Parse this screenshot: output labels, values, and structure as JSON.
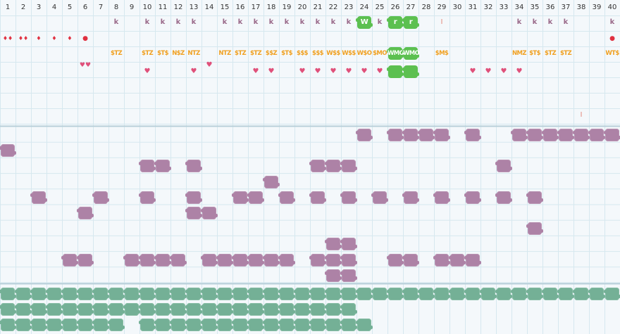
{
  "columns": [
    1,
    2,
    3,
    4,
    5,
    6,
    7,
    8,
    9,
    10,
    11,
    12,
    13,
    14,
    15,
    16,
    17,
    18,
    19,
    20,
    21,
    22,
    23,
    24,
    25,
    26,
    27,
    28,
    29,
    30,
    31,
    32,
    33,
    34,
    35,
    36,
    37,
    38,
    39,
    40
  ],
  "colors": {
    "background": "#f4f8fb",
    "grid": "#d6e8ef",
    "purple_blob": "#ad82a6",
    "green_blob": "#74b096",
    "bright_green": "#5cc050",
    "heart": "#e0507a",
    "label_orange": "#f0a020",
    "k_letter": "#9a6a8a"
  },
  "k_row": {
    "text": "k",
    "cols": [
      8,
      10,
      11,
      12,
      13,
      15,
      16,
      17,
      18,
      19,
      20,
      21,
      22,
      23,
      25,
      34,
      35,
      36,
      37,
      40
    ]
  },
  "bright_row": [
    {
      "col": 24,
      "text": "W"
    },
    {
      "col": 26,
      "text": "r"
    },
    {
      "col": 27,
      "text": "r"
    }
  ],
  "l_marks": [
    {
      "col": 29,
      "text": "l"
    },
    {
      "col": 38,
      "text": "l"
    }
  ],
  "drop_row": [
    {
      "col": 1,
      "text": "♦♦"
    },
    {
      "col": 2,
      "text": "♦♦"
    },
    {
      "col": 3,
      "text": "♦"
    },
    {
      "col": 4,
      "text": "♦"
    },
    {
      "col": 5,
      "text": "♦"
    },
    {
      "col": 6,
      "text": "●"
    },
    {
      "col": 40,
      "text": "●"
    }
  ],
  "label_row": [
    {
      "col": 8,
      "text": "$TZ"
    },
    {
      "col": 10,
      "text": "$TZ"
    },
    {
      "col": 11,
      "text": "$T$"
    },
    {
      "col": 12,
      "text": "N$Z"
    },
    {
      "col": 13,
      "text": "NTZ"
    },
    {
      "col": 15,
      "text": "NTZ"
    },
    {
      "col": 16,
      "text": "$TZ"
    },
    {
      "col": 17,
      "text": "$TZ"
    },
    {
      "col": 18,
      "text": "$$Z"
    },
    {
      "col": 19,
      "text": "$T$"
    },
    {
      "col": 20,
      "text": "$$$"
    },
    {
      "col": 21,
      "text": "$$$"
    },
    {
      "col": 22,
      "text": "W$$"
    },
    {
      "col": 23,
      "text": "W$$"
    },
    {
      "col": 24,
      "text": "W$O"
    },
    {
      "col": 25,
      "text": "$MO"
    },
    {
      "col": 29,
      "text": "$M$"
    },
    {
      "col": 34,
      "text": "NMZ"
    },
    {
      "col": 35,
      "text": "$T$"
    },
    {
      "col": 36,
      "text": "$TZ"
    },
    {
      "col": 37,
      "text": "$TZ"
    },
    {
      "col": 40,
      "text": "WT$"
    }
  ],
  "bright_label_row": [
    {
      "col": 26,
      "text": "WMO"
    },
    {
      "col": 27,
      "text": "WMO"
    }
  ],
  "heart_row": {
    "text": "♥",
    "cols": [
      10,
      13,
      17,
      18,
      20,
      21,
      22,
      23,
      24,
      25,
      31,
      32,
      33,
      34
    ]
  },
  "heart_special": [
    {
      "col": 6,
      "text": "♥♥"
    },
    {
      "col": 14,
      "text": "♥"
    }
  ],
  "bright_heart_row": [
    26,
    27
  ],
  "purple_rows": [
    [
      24,
      26,
      27,
      28,
      29,
      31,
      34,
      35,
      36,
      37,
      38,
      39,
      40
    ],
    [
      1
    ],
    [
      10,
      11,
      13,
      21,
      22,
      23,
      33
    ],
    [
      18
    ],
    [
      3,
      7,
      10,
      13,
      16,
      17,
      19,
      21,
      23,
      25,
      27,
      29,
      31,
      33,
      35
    ],
    [
      6,
      13,
      14
    ],
    [
      35
    ],
    [
      22,
      23
    ],
    [
      5,
      6,
      9,
      10,
      11,
      12,
      14,
      15,
      16,
      17,
      18,
      19,
      21,
      22,
      23,
      26,
      27,
      29,
      30,
      31
    ],
    [
      22,
      23
    ]
  ],
  "green_rows": [
    [
      1,
      2,
      3,
      4,
      5,
      6,
      7,
      8,
      9,
      10,
      11,
      12,
      13,
      14,
      15,
      16,
      17,
      18,
      19,
      20,
      21,
      22,
      23,
      24,
      25,
      26,
      27,
      28,
      29,
      30,
      31,
      32,
      33,
      34,
      35,
      36,
      37,
      38,
      39,
      40
    ],
    [
      1,
      2,
      3,
      4,
      5,
      6,
      7,
      8,
      9,
      10,
      11,
      12,
      13,
      14,
      15,
      16,
      17,
      18,
      19,
      20,
      21,
      22,
      23
    ],
    [
      1,
      2,
      3,
      4,
      5,
      6,
      7,
      8,
      10,
      11,
      12,
      13,
      14,
      15,
      16,
      17,
      18,
      19,
      20,
      21,
      22,
      23,
      24
    ]
  ]
}
